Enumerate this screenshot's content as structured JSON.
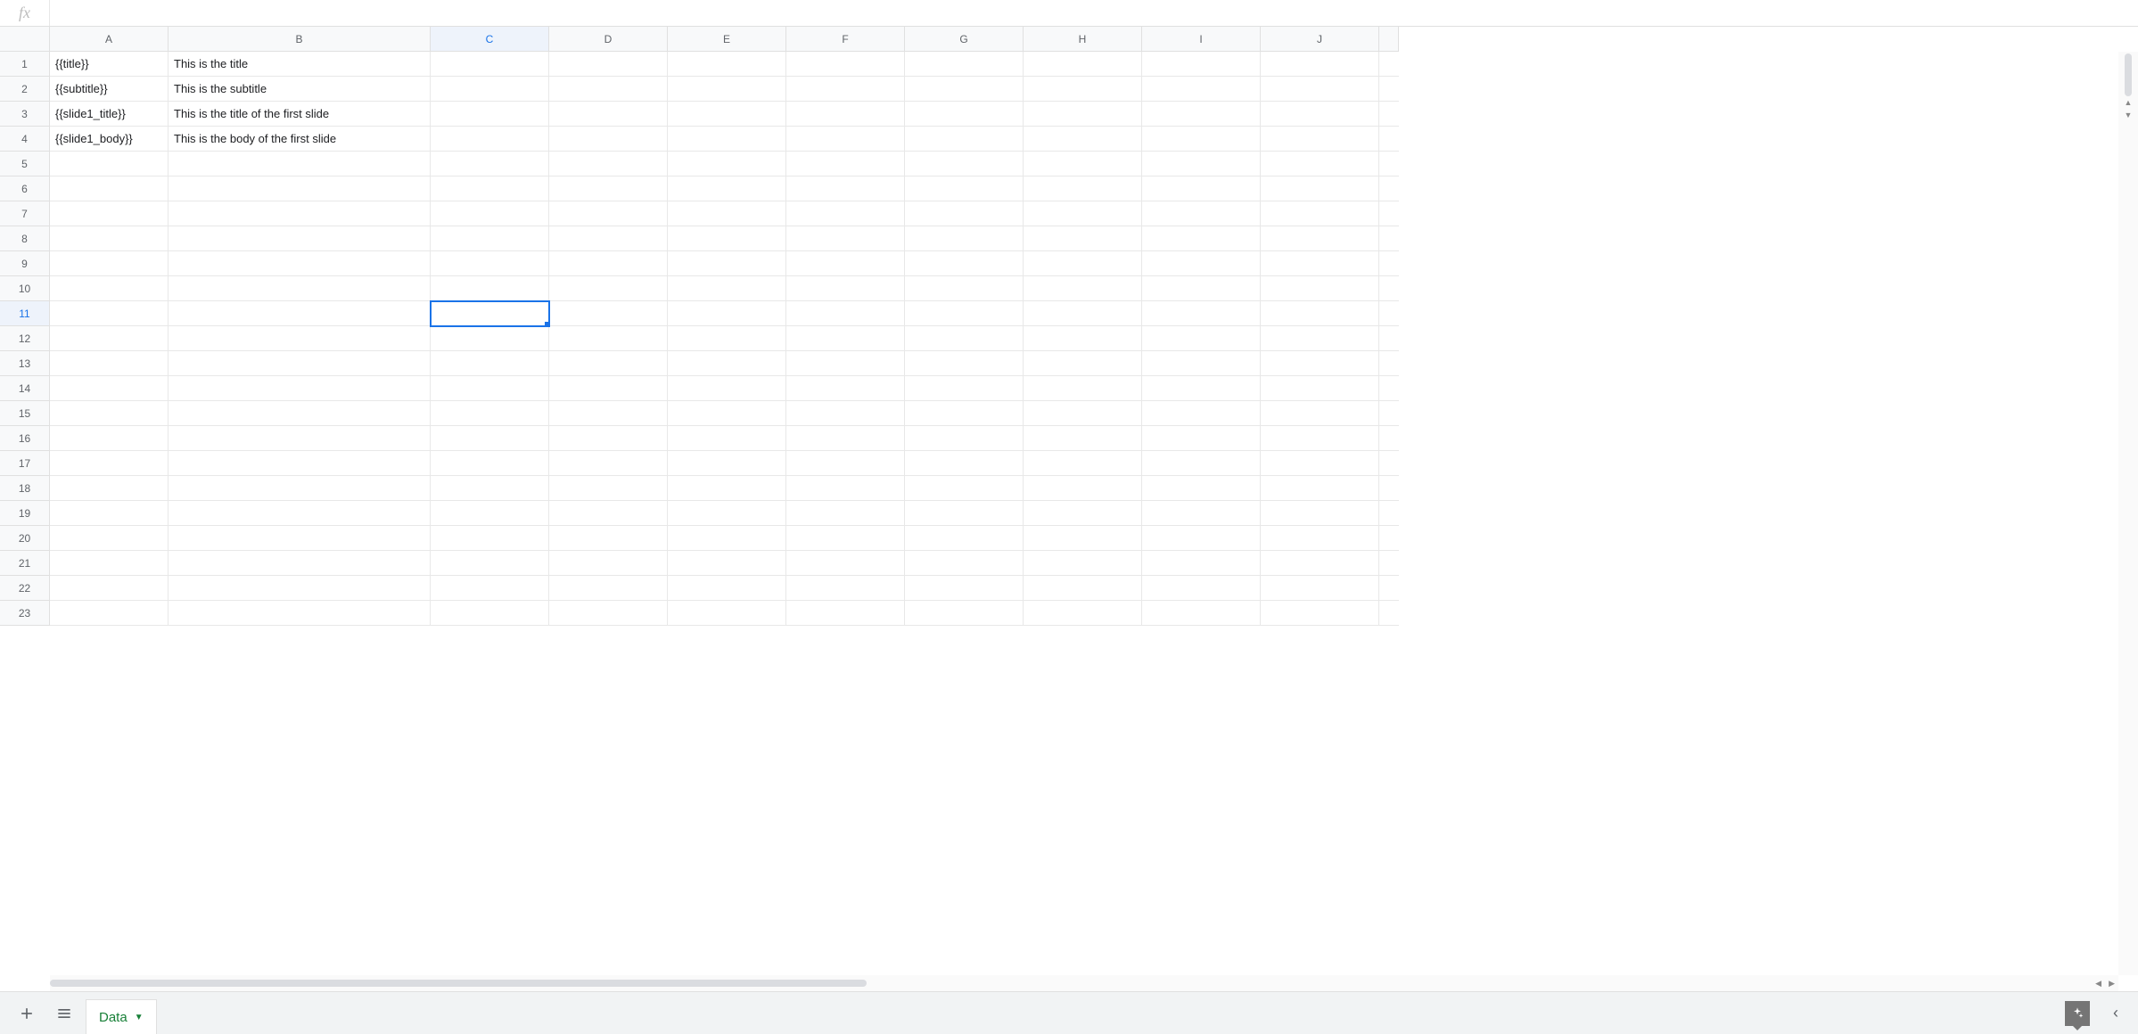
{
  "formula_bar": {
    "fx_label": "fx",
    "value": ""
  },
  "columns": [
    "A",
    "B",
    "C",
    "D",
    "E",
    "F",
    "G",
    "H",
    "I",
    "J"
  ],
  "row_count": 23,
  "selected": {
    "col_index": 2,
    "row_index": 10,
    "col_label": "C",
    "row_label": "11"
  },
  "cells": {
    "A1": "{{title}}",
    "B1": "This is the title",
    "A2": "{{subtitle}}",
    "B2": "This is the subtitle",
    "A3": "{{slide1_title}}",
    "B3": "This is the title of the first slide",
    "A4": "{{slide1_body}}",
    "B4": "This is the body of the first slide"
  },
  "sheet_tab": {
    "name": "Data"
  }
}
